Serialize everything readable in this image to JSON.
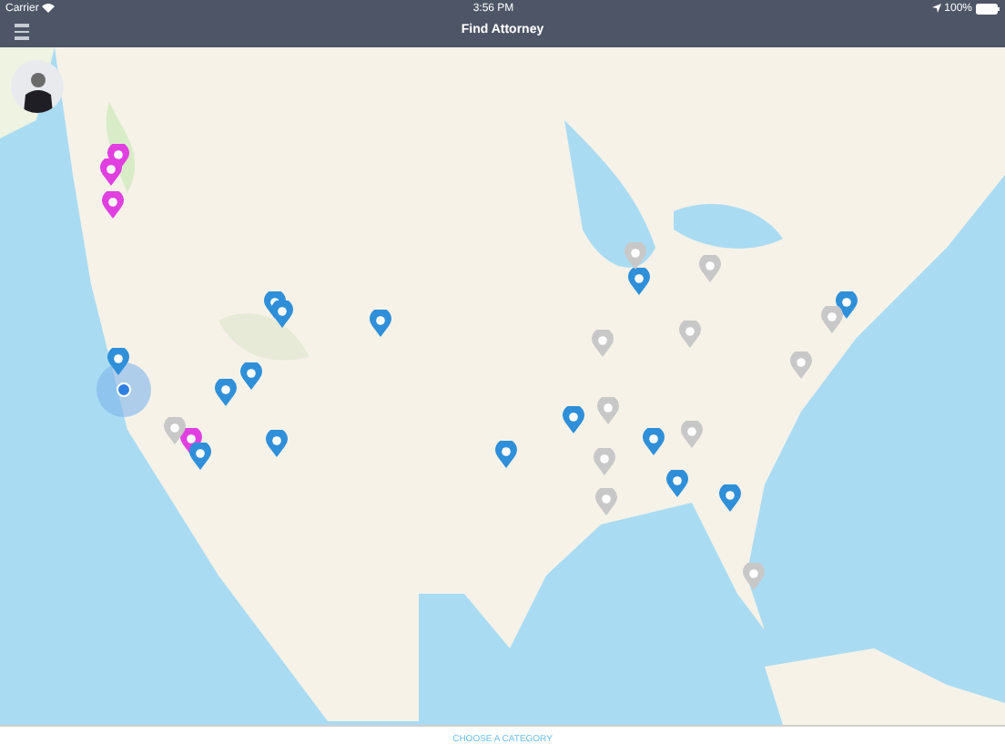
{
  "status_bar": {
    "carrier": "Carrier",
    "time": "3:56 PM",
    "battery": "100%"
  },
  "nav_bar": {
    "title": "Find Attorney"
  },
  "map": {
    "kind": "picture",
    "pins": [
      {
        "color": "#e040e0"
      },
      {
        "color": "#e040e0"
      },
      {
        "color": "#e040e0"
      },
      {
        "color": "#e040e0"
      },
      {
        "color": "#2f8fd8"
      },
      {
        "color": "#2f8fd8"
      },
      {
        "color": "#2f8fd8"
      },
      {
        "color": "#2f8fd8"
      },
      {
        "color": "#2f8fd8"
      },
      {
        "color": "#2f8fd8"
      },
      {
        "color": "#2f8fd8"
      },
      {
        "color": "#2f8fd8"
      },
      {
        "color": "#2f8fd8"
      },
      {
        "color": "#2f8fd8"
      },
      {
        "color": "#2f8fd8"
      },
      {
        "color": "#2f8fd8"
      },
      {
        "color": "#2f8fd8"
      },
      {
        "color": "#2f8fd8"
      },
      {
        "color": "#2f8fd8"
      },
      {
        "color": "#c8c8c8"
      },
      {
        "color": "#c8c8c8"
      },
      {
        "color": "#c8c8c8"
      },
      {
        "color": "#c8c8c8"
      },
      {
        "color": "#c8c8c8"
      },
      {
        "color": "#c8c8c8"
      },
      {
        "color": "#c8c8c8"
      },
      {
        "color": "#c8c8c8"
      },
      {
        "color": "#c8c8c8"
      },
      {
        "color": "#c8c8c8"
      },
      {
        "color": "#c8c8c8"
      },
      {
        "color": "#c8c8c8"
      }
    ]
  },
  "bottom_bar": {
    "button": "CHOOSE A CATEGORY"
  }
}
